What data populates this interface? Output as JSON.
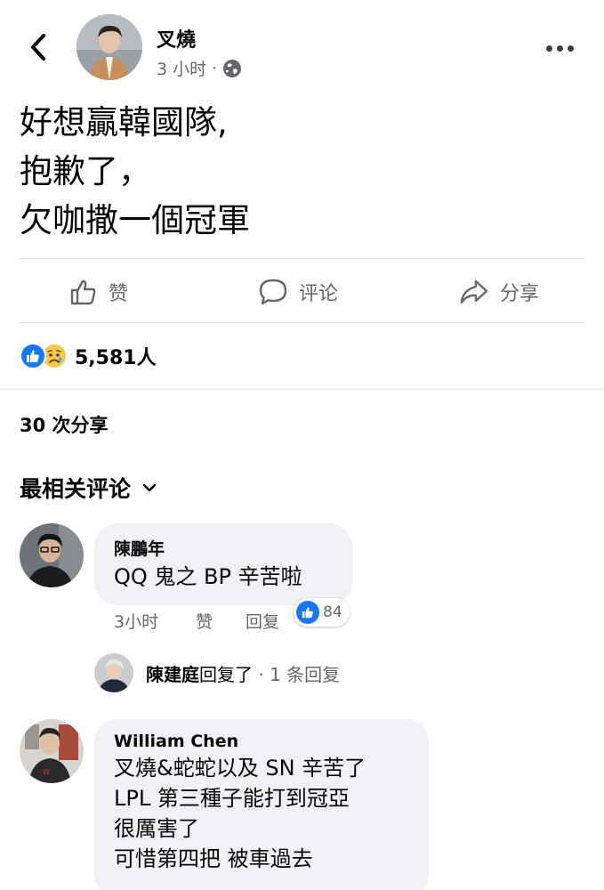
{
  "post": {
    "author": "叉燒",
    "time": "3 小时",
    "dot": "·",
    "privacy_icon": "globe-icon",
    "lines": [
      "好想贏韓國隊,",
      "抱歉了，",
      "欠咖撒一個冠軍"
    ]
  },
  "actions": {
    "like": "赞",
    "comment": "评论",
    "share": "分享"
  },
  "reactions": {
    "types": [
      "like",
      "sad"
    ],
    "count": "5,581人"
  },
  "shares": "30 次分享",
  "sort": {
    "label": "最相关评论"
  },
  "comments": [
    {
      "author": "陳鵬年",
      "lines": [
        "QQ 鬼之 BP 辛苦啦"
      ],
      "time": "3小时",
      "like": "赞",
      "reply": "回复",
      "likes": "84"
    },
    {
      "author": "William Chen",
      "lines": [
        "叉燒&蛇蛇以及 SN 辛苦了",
        "LPL 第三種子能打到冠亞",
        "很厲害了",
        "可惜第四把 被車過去"
      ]
    }
  ],
  "reply_summary": {
    "name": "陳建庭",
    "action": "回复了",
    "count": "· 1 条回复"
  },
  "colors": {
    "accent": "#1877f2",
    "muted": "#65676b",
    "bubble": "#f0f2f5"
  }
}
